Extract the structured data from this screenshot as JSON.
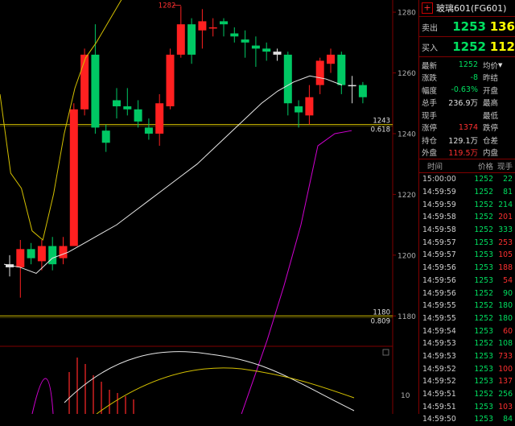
{
  "chart_data": {
    "type": "candlestick",
    "y_range": [
      1170,
      1284
    ],
    "y_ticks": [
      1280,
      1260,
      1240,
      1220,
      1200,
      1180
    ],
    "levels": [
      {
        "price": 1243,
        "label": "1243",
        "ratio": "0.618"
      },
      {
        "price": 1180,
        "label": "1180",
        "ratio": "0.809"
      }
    ],
    "peak_label": "1282",
    "candles": [
      {
        "o": 1196,
        "c": 1197,
        "h": 1200,
        "l": 1193,
        "dir": "flat"
      },
      {
        "o": 1196,
        "c": 1202,
        "h": 1205,
        "l": 1186,
        "dir": "up"
      },
      {
        "o": 1202,
        "c": 1199,
        "h": 1204,
        "l": 1197,
        "dir": "down"
      },
      {
        "o": 1198,
        "c": 1203,
        "h": 1205,
        "l": 1195,
        "dir": "up"
      },
      {
        "o": 1203,
        "c": 1197,
        "h": 1206,
        "l": 1195,
        "dir": "down"
      },
      {
        "o": 1199,
        "c": 1203,
        "h": 1206,
        "l": 1197,
        "dir": "up"
      },
      {
        "o": 1203,
        "c": 1248,
        "h": 1250,
        "l": 1203,
        "dir": "up"
      },
      {
        "o": 1248,
        "c": 1266,
        "h": 1268,
        "l": 1246,
        "dir": "up"
      },
      {
        "o": 1242,
        "c": 1266,
        "h": 1276,
        "l": 1240,
        "dir": "down"
      },
      {
        "o": 1241,
        "c": 1237,
        "h": 1243,
        "l": 1234,
        "dir": "down"
      },
      {
        "o": 1251,
        "c": 1249,
        "h": 1255,
        "l": 1245,
        "dir": "down"
      },
      {
        "o": 1249,
        "c": 1248,
        "h": 1255,
        "l": 1246,
        "dir": "down"
      },
      {
        "o": 1248,
        "c": 1244,
        "h": 1251,
        "l": 1242,
        "dir": "down"
      },
      {
        "o": 1242,
        "c": 1240,
        "h": 1245,
        "l": 1238,
        "dir": "down"
      },
      {
        "o": 1240,
        "c": 1250,
        "h": 1253,
        "l": 1236,
        "dir": "up"
      },
      {
        "o": 1249,
        "c": 1266,
        "h": 1268,
        "l": 1248,
        "dir": "up"
      },
      {
        "o": 1266,
        "c": 1276,
        "h": 1282,
        "l": 1265,
        "dir": "up"
      },
      {
        "o": 1266,
        "c": 1276,
        "h": 1278,
        "l": 1263,
        "dir": "down"
      },
      {
        "o": 1274,
        "c": 1277,
        "h": 1281,
        "l": 1268,
        "dir": "up"
      },
      {
        "o": 1275,
        "c": 1275,
        "h": 1278,
        "l": 1272,
        "dir": "up"
      },
      {
        "o": 1277,
        "c": 1276,
        "h": 1278,
        "l": 1272,
        "dir": "down"
      },
      {
        "o": 1272,
        "c": 1273,
        "h": 1275,
        "l": 1270,
        "dir": "down"
      },
      {
        "o": 1271,
        "c": 1270,
        "h": 1274,
        "l": 1265,
        "dir": "down"
      },
      {
        "o": 1269,
        "c": 1268,
        "h": 1272,
        "l": 1262,
        "dir": "down"
      },
      {
        "o": 1268,
        "c": 1267,
        "h": 1270,
        "l": 1264,
        "dir": "down"
      },
      {
        "o": 1267,
        "c": 1266,
        "h": 1268,
        "l": 1264,
        "dir": "flat"
      },
      {
        "o": 1266,
        "c": 1250,
        "h": 1267,
        "l": 1246,
        "dir": "down"
      },
      {
        "o": 1249,
        "c": 1247,
        "h": 1251,
        "l": 1242,
        "dir": "down"
      },
      {
        "o": 1246,
        "c": 1252,
        "h": 1256,
        "l": 1243,
        "dir": "up"
      },
      {
        "o": 1256,
        "c": 1264,
        "h": 1265,
        "l": 1253,
        "dir": "up"
      },
      {
        "o": 1263,
        "c": 1266,
        "h": 1268,
        "l": 1260,
        "dir": "up"
      },
      {
        "o": 1266,
        "c": 1256,
        "h": 1267,
        "l": 1253,
        "dir": "down"
      },
      {
        "o": 1256,
        "c": 1256,
        "h": 1259,
        "l": 1250,
        "dir": "flat"
      },
      {
        "o": 1256,
        "c": 1252,
        "h": 1257,
        "l": 1250,
        "dir": "down"
      }
    ],
    "ma_lines": {
      "yellow_upper": [
        1253,
        1227,
        1222,
        1208,
        1205,
        1220,
        1240,
        1255,
        1265,
        1270,
        1276,
        1282,
        1288,
        1293,
        1298,
        1303,
        1308
      ],
      "white": [
        1197,
        1196,
        1194,
        1199,
        1201,
        1204,
        1207,
        1210,
        1214,
        1218,
        1222,
        1226,
        1230,
        1235,
        1240,
        1245,
        1250,
        1254,
        1257,
        1259,
        1258,
        1256
      ],
      "magenta": [
        1140,
        1156,
        1172,
        1190,
        1210,
        1236,
        1240,
        1241
      ]
    },
    "sub_axis_labels": [
      "10"
    ]
  },
  "panel": {
    "title": "玻璃601(FG601)",
    "ask_label": "卖出",
    "ask_price": "1253",
    "ask_vol": "136",
    "bid_label": "买入",
    "bid_price": "1252",
    "bid_vol": "112",
    "stats": [
      {
        "k": "最新",
        "v": "1252",
        "vclass": "green",
        "k2": "均价",
        "tri": "▼",
        "v2": ""
      },
      {
        "k": "涨跌",
        "v": "-8",
        "vclass": "green",
        "k2": "昨结",
        "v2": ""
      },
      {
        "k": "幅度",
        "v": "-0.63%",
        "vclass": "green",
        "k2": "开盘",
        "v2": ""
      },
      {
        "k": "总手",
        "v": "236.9万",
        "vclass": "white",
        "k2": "最高",
        "v2": ""
      },
      {
        "k": "现手",
        "v": "",
        "vclass": "white",
        "k2": "最低",
        "v2": ""
      },
      {
        "k": "涨停",
        "v": "1374",
        "vclass": "red",
        "k2": "跌停",
        "v2": ""
      },
      {
        "k": "持仓",
        "v": "129.1万",
        "vclass": "white",
        "k2": "仓差",
        "v2": ""
      },
      {
        "k": "外盘",
        "v": "119.5万",
        "vclass": "red",
        "k2": "内盘",
        "v2": ""
      }
    ],
    "trade_header": {
      "time": "时间",
      "price": "价格",
      "vol": "现手"
    },
    "trades": [
      {
        "t": "15:00:00",
        "p": "1252",
        "v": "22",
        "c": "green"
      },
      {
        "t": "14:59:59",
        "p": "1252",
        "v": "81",
        "c": "green"
      },
      {
        "t": "14:59:59",
        "p": "1252",
        "v": "214",
        "c": "green"
      },
      {
        "t": "14:59:58",
        "p": "1252",
        "v": "201",
        "c": "red"
      },
      {
        "t": "14:59:58",
        "p": "1252",
        "v": "333",
        "c": "green"
      },
      {
        "t": "14:59:57",
        "p": "1253",
        "v": "253",
        "c": "red"
      },
      {
        "t": "14:59:57",
        "p": "1253",
        "v": "105",
        "c": "red"
      },
      {
        "t": "14:59:56",
        "p": "1253",
        "v": "188",
        "c": "red"
      },
      {
        "t": "14:59:56",
        "p": "1253",
        "v": "54",
        "c": "red"
      },
      {
        "t": "14:59:56",
        "p": "1252",
        "v": "90",
        "c": "green"
      },
      {
        "t": "14:59:55",
        "p": "1252",
        "v": "180",
        "c": "green"
      },
      {
        "t": "14:59:55",
        "p": "1252",
        "v": "180",
        "c": "green"
      },
      {
        "t": "14:59:54",
        "p": "1253",
        "v": "60",
        "c": "red"
      },
      {
        "t": "14:59:53",
        "p": "1252",
        "v": "108",
        "c": "green"
      },
      {
        "t": "14:59:53",
        "p": "1253",
        "v": "733",
        "c": "red"
      },
      {
        "t": "14:59:52",
        "p": "1253",
        "v": "100",
        "c": "red"
      },
      {
        "t": "14:59:52",
        "p": "1253",
        "v": "137",
        "c": "red"
      },
      {
        "t": "14:59:51",
        "p": "1252",
        "v": "256",
        "c": "green"
      },
      {
        "t": "14:59:51",
        "p": "1253",
        "v": "103",
        "c": "red"
      },
      {
        "t": "14:59:50",
        "p": "1253",
        "v": "84",
        "c": "green"
      }
    ]
  }
}
